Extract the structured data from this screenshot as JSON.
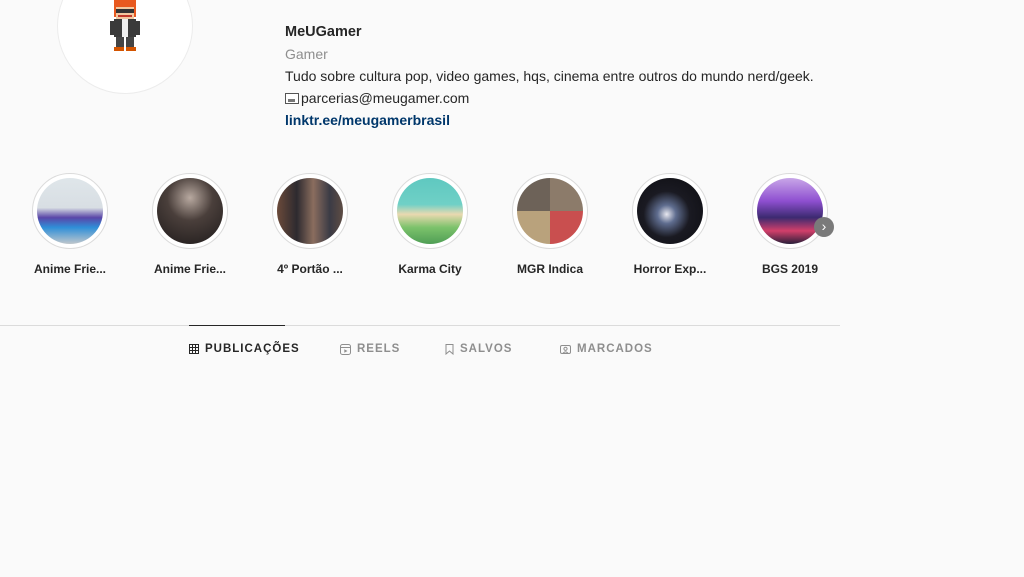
{
  "profile": {
    "username": "MeUGamer",
    "category": "Gamer",
    "bio": "Tudo sobre cultura pop, video games, hqs, cinema entre outros do mundo nerd/geek.",
    "email": "parcerias@meugamer.com",
    "link": "linktr.ee/meugamerbrasil"
  },
  "highlights": [
    {
      "label": "Anime Frie...",
      "icon": "highlight-photo"
    },
    {
      "label": "Anime Frie...",
      "icon": "highlight-photo"
    },
    {
      "label": "4º Portão ...",
      "icon": "highlight-photo"
    },
    {
      "label": "Karma City",
      "icon": "highlight-photo"
    },
    {
      "label": "MGR Indica",
      "icon": "highlight-photo"
    },
    {
      "label": "Horror Exp...",
      "icon": "highlight-photo"
    },
    {
      "label": "BGS 2019",
      "icon": "highlight-photo"
    }
  ],
  "highlights_next": "›",
  "tabs": [
    {
      "label": "PUBLICAÇÕES",
      "icon": "grid-icon",
      "active": true
    },
    {
      "label": "REELS",
      "icon": "reels-icon",
      "active": false
    },
    {
      "label": "SALVOS",
      "icon": "bookmark-icon",
      "active": false
    },
    {
      "label": "MARCADOS",
      "icon": "tagged-icon",
      "active": false
    }
  ],
  "colors": {
    "background": "#fafafa",
    "text": "#262626",
    "muted": "#8e8e8e",
    "link": "#00376b",
    "border": "#dbdbdb"
  }
}
